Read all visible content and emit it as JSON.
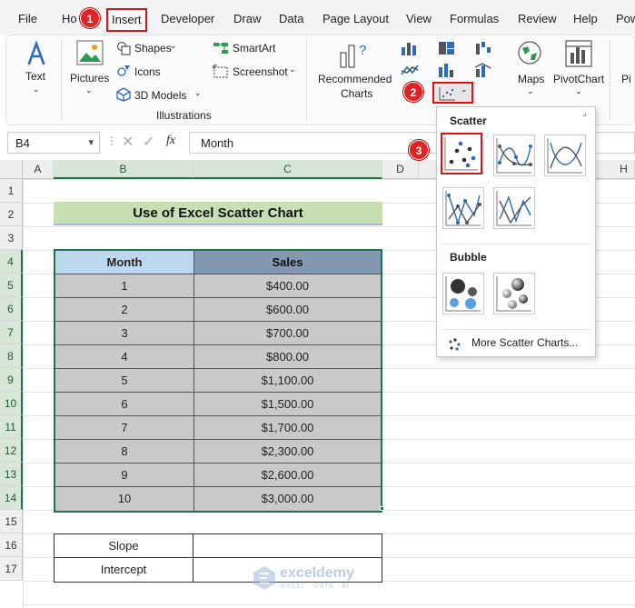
{
  "menu": {
    "items": [
      "File",
      "Ho",
      "Insert",
      "Developer",
      "Draw",
      "Data",
      "Page Layout",
      "View",
      "Formulas",
      "Review",
      "Help",
      "Pow"
    ]
  },
  "steps": [
    "1",
    "2",
    "3"
  ],
  "ribbon": {
    "text_label": "Text",
    "pictures_label": "Pictures",
    "shapes_label": "Shapes",
    "icons_label": "Icons",
    "models_label": "3D Models",
    "smartart_label": "SmartArt",
    "screenshot_label": "Screenshot",
    "illustrations_group": "Illustrations",
    "recommended_line1": "Recommended",
    "recommended_line2": "Charts",
    "maps_label": "Maps",
    "pivotchart_label": "PivotChart",
    "pi_label": "Pi"
  },
  "formula_bar": {
    "cell_ref": "B4",
    "fx": "fx",
    "value": "Month"
  },
  "columns": [
    "A",
    "B",
    "C",
    "D",
    "H"
  ],
  "rows": [
    "1",
    "2",
    "3",
    "4",
    "5",
    "6",
    "7",
    "8",
    "9",
    "10",
    "11",
    "12",
    "13",
    "14",
    "15",
    "16",
    "17"
  ],
  "sheet": {
    "title": "Use of Excel Scatter Chart",
    "headers": [
      "Month",
      "Sales"
    ],
    "data": [
      [
        "1",
        "$400.00"
      ],
      [
        "2",
        "$600.00"
      ],
      [
        "3",
        "$700.00"
      ],
      [
        "4",
        "$800.00"
      ],
      [
        "5",
        "$1,100.00"
      ],
      [
        "6",
        "$1,500.00"
      ],
      [
        "7",
        "$1,700.00"
      ],
      [
        "8",
        "$2,300.00"
      ],
      [
        "9",
        "$2,600.00"
      ],
      [
        "10",
        "$3,000.00"
      ]
    ],
    "slope_label": "Slope",
    "intercept_label": "Intercept"
  },
  "dropdown": {
    "scatter_header": "Scatter",
    "bubble_header": "Bubble",
    "more_link": "More Scatter Charts..."
  },
  "watermark": {
    "brand": "exceldemy",
    "tagline": "EXCEL · DATA · BI"
  },
  "colors": {
    "accent": "#217346",
    "highlight": "#dd1111",
    "title_fill": "#c6e0b4",
    "month_header": "#bdd7ee",
    "sales_header": "#8497b0",
    "data_fill": "#c9c9c9"
  }
}
